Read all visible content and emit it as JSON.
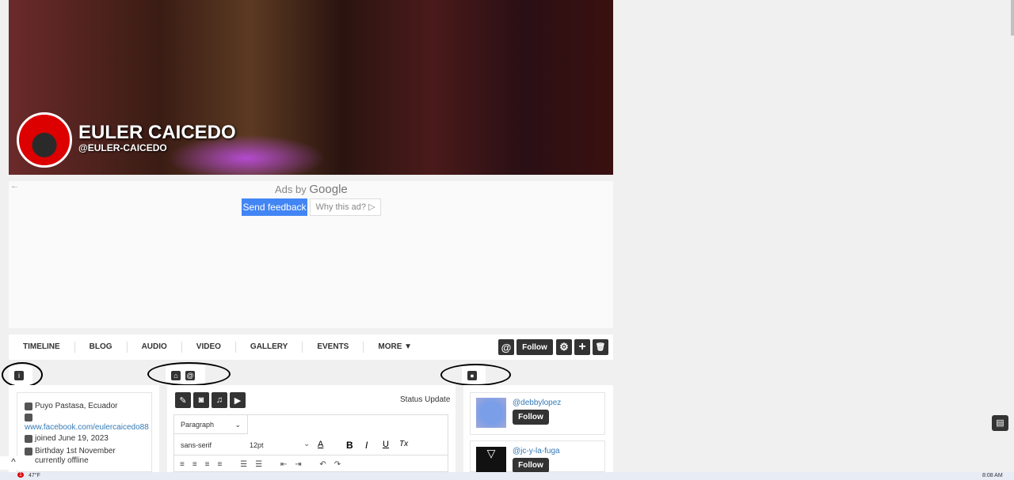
{
  "profile": {
    "name": "EULER CAICEDO",
    "handle": "@EULER-CAICEDO"
  },
  "ad": {
    "back": "←",
    "ads_by": "Ads by",
    "google": "Google",
    "send_feedback": "Send feedback",
    "why": "Why this ad? ▷"
  },
  "nav": {
    "items": [
      "TIMELINE",
      "BLOG",
      "AUDIO",
      "VIDEO",
      "GALLERY",
      "EVENTS",
      "MORE ▼"
    ],
    "mention": "@",
    "follow": "Follow",
    "gear": "⚙",
    "add": "+",
    "trash": "🗑"
  },
  "info": {
    "location": "Puyo Pastasa, Ecuador",
    "website": "www.facebook.com/eulercaicedo88",
    "joined": "joined June 19, 2023",
    "birthday": "Birthday 1st November",
    "status": "currently offline"
  },
  "editor": {
    "status_update": "Status Update",
    "block": "Paragraph",
    "font": "sans-serif",
    "size": "12pt",
    "bold": "B",
    "italic": "I",
    "underline": "U",
    "clear": "Tx",
    "color": "A"
  },
  "suggestions": [
    {
      "handle": "@debbylopez",
      "follow": "Follow"
    },
    {
      "handle": "@jc-y-la-fuga",
      "follow": "Follow"
    }
  ],
  "taskbar": {
    "weather": "47°F",
    "time": "8:08 AM",
    "badge": "1"
  },
  "scroll_up": "^"
}
